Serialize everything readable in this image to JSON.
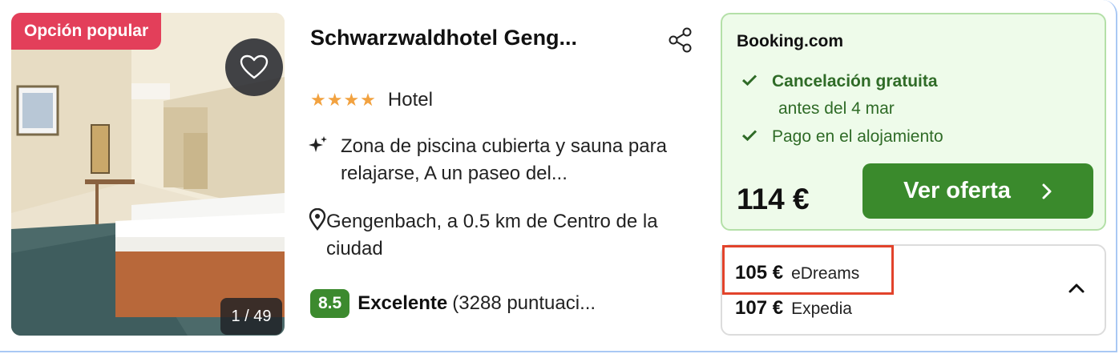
{
  "badge": "Opción popular",
  "photo": {
    "counter": "1 / 49"
  },
  "hotel": {
    "name": "Schwarzwaldhotel Geng...",
    "stars": "★★★★",
    "type": "Hotel",
    "feature": "Zona de piscina cubierta y sauna para relajarse, A un paseo del...",
    "location": "Gengenbach, a 0.5 km de Centro de la ciudad",
    "rating": {
      "score": "8.5",
      "label": "Excelente",
      "count": "(3288 puntuaci..."
    }
  },
  "offer": {
    "provider": "Booking.com",
    "perk_title": "Cancelación gratuita",
    "perk_detail": "antes del 4 mar",
    "perk_payment": "Pago en el alojamiento",
    "price": "114 €",
    "cta_label": "Ver oferta"
  },
  "alternatives": [
    {
      "price": "105 €",
      "site": "eDreams"
    },
    {
      "price": "107 €",
      "site": "Expedia"
    }
  ],
  "colors": {
    "badge": "#e33f5a",
    "cta": "#3a8a2c",
    "score": "#3c8a2e",
    "stars": "#f2a240",
    "highlight": "#e2432b"
  }
}
